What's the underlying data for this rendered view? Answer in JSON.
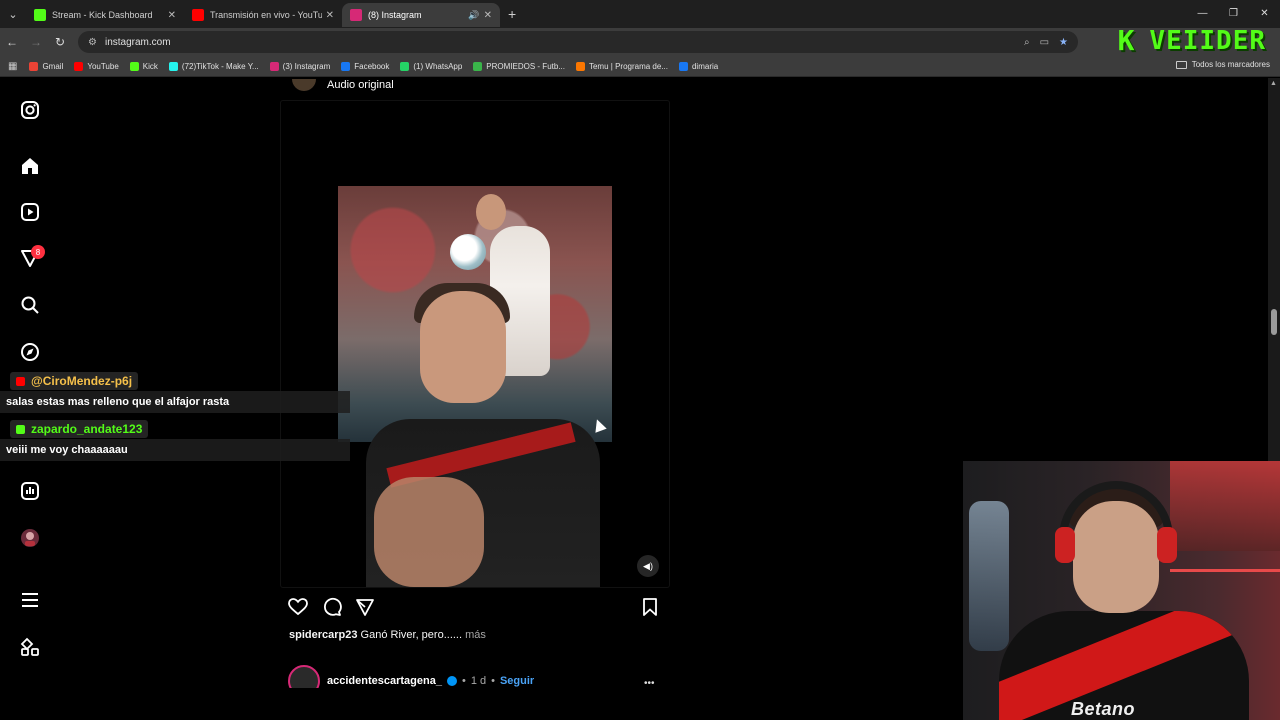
{
  "browser": {
    "tabs": [
      {
        "title": "Stream - Kick Dashboard",
        "fav_color": "#53fc18"
      },
      {
        "title": "Transmisión en vivo - YouTube",
        "fav_color": "#ff0000"
      },
      {
        "title": "(8) Instagram",
        "fav_color": "#d62976"
      }
    ],
    "url": "instagram.com",
    "bookmarks": [
      {
        "label": "Gmail",
        "color": "#ea4335"
      },
      {
        "label": "YouTube",
        "color": "#ff0000"
      },
      {
        "label": "Kick",
        "color": "#53fc18"
      },
      {
        "label": "(72)TikTok - Make Y...",
        "color": "#25f4ee"
      },
      {
        "label": "(3) Instagram",
        "color": "#d62976"
      },
      {
        "label": "Facebook",
        "color": "#1877f2"
      },
      {
        "label": "(1) WhatsApp",
        "color": "#25d366"
      },
      {
        "label": "PROMIEDOS - Futb...",
        "color": "#3ab54a"
      },
      {
        "label": "Temu | Programa de...",
        "color": "#fb7701"
      },
      {
        "label": "dimaria",
        "color": "#1877f2"
      }
    ],
    "all_bookmarks": "Todos los marcadores"
  },
  "overlay": {
    "kick_logo_letter": "K",
    "channel_name": "VEIIDER"
  },
  "instagram": {
    "nav_icons": [
      "instagram-logo-icon",
      "home-icon",
      "reels-icon",
      "notifications-icon",
      "search-icon",
      "explore-icon",
      "insights-icon",
      "profile-avatar",
      "menu-icon",
      "more-apps-icon"
    ],
    "notification_badge": "8",
    "audio_label": "Audio original",
    "post": {
      "username": "spidercarp23",
      "caption": "Ganó River, pero......",
      "more_label": "más"
    },
    "next_post": {
      "username": "accidentescartagena_",
      "time": "1 d",
      "follow_label": "Seguir"
    }
  },
  "chat": [
    {
      "user": "@CiroMendez-p6j",
      "platform": "youtube",
      "user_color": "#f5c04a",
      "message": "salas estas mas relleno que el alfajor rasta"
    },
    {
      "user": "zapardo_andate123",
      "platform": "kick",
      "user_color": "#53fc18",
      "message": "veiii me voy chaaaaaau"
    }
  ],
  "webcam": {
    "jersey_sponsor": "Betano"
  }
}
